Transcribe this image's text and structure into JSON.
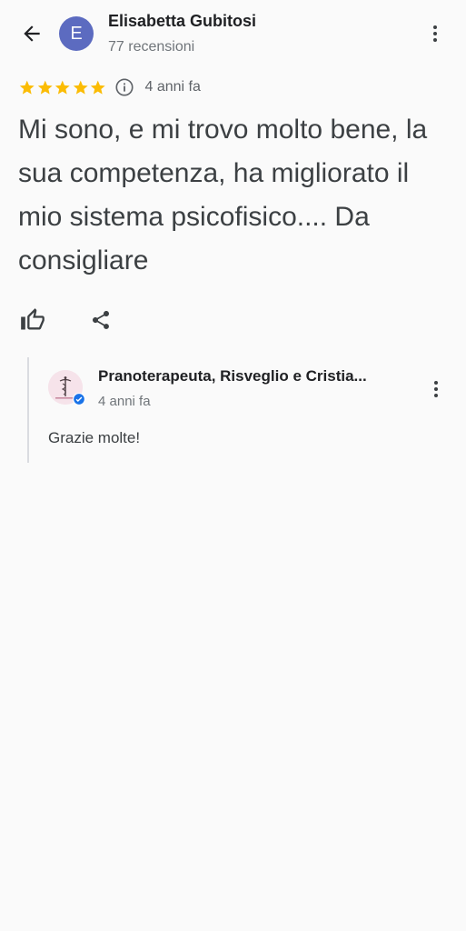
{
  "header": {
    "avatar_letter": "E",
    "reviewer_name": "Elisabetta Gubitosi",
    "reviewer_reviews": "77 recensioni"
  },
  "review": {
    "rating": 5,
    "max_rating": 5,
    "date": "4 anni fa",
    "text": "Mi sono, e mi trovo molto bene, la sua competenza, ha migliorato il mio sistema psicofisico.... Da consigliare"
  },
  "response": {
    "owner_name": "Pranoterapeuta, Risveglio e Cristia...",
    "date": "4 anni fa",
    "text": "Grazie molte!"
  },
  "colors": {
    "star": "#fbbc04",
    "avatar_bg": "#5c6bc0",
    "verified": "#1a73e8",
    "background": "#fafafa"
  },
  "icons": {
    "back": "arrow-left-icon",
    "more": "more-vertical-icon",
    "info": "info-icon",
    "like": "thumbs-up-icon",
    "share": "share-icon",
    "verified": "verified-check-icon"
  }
}
